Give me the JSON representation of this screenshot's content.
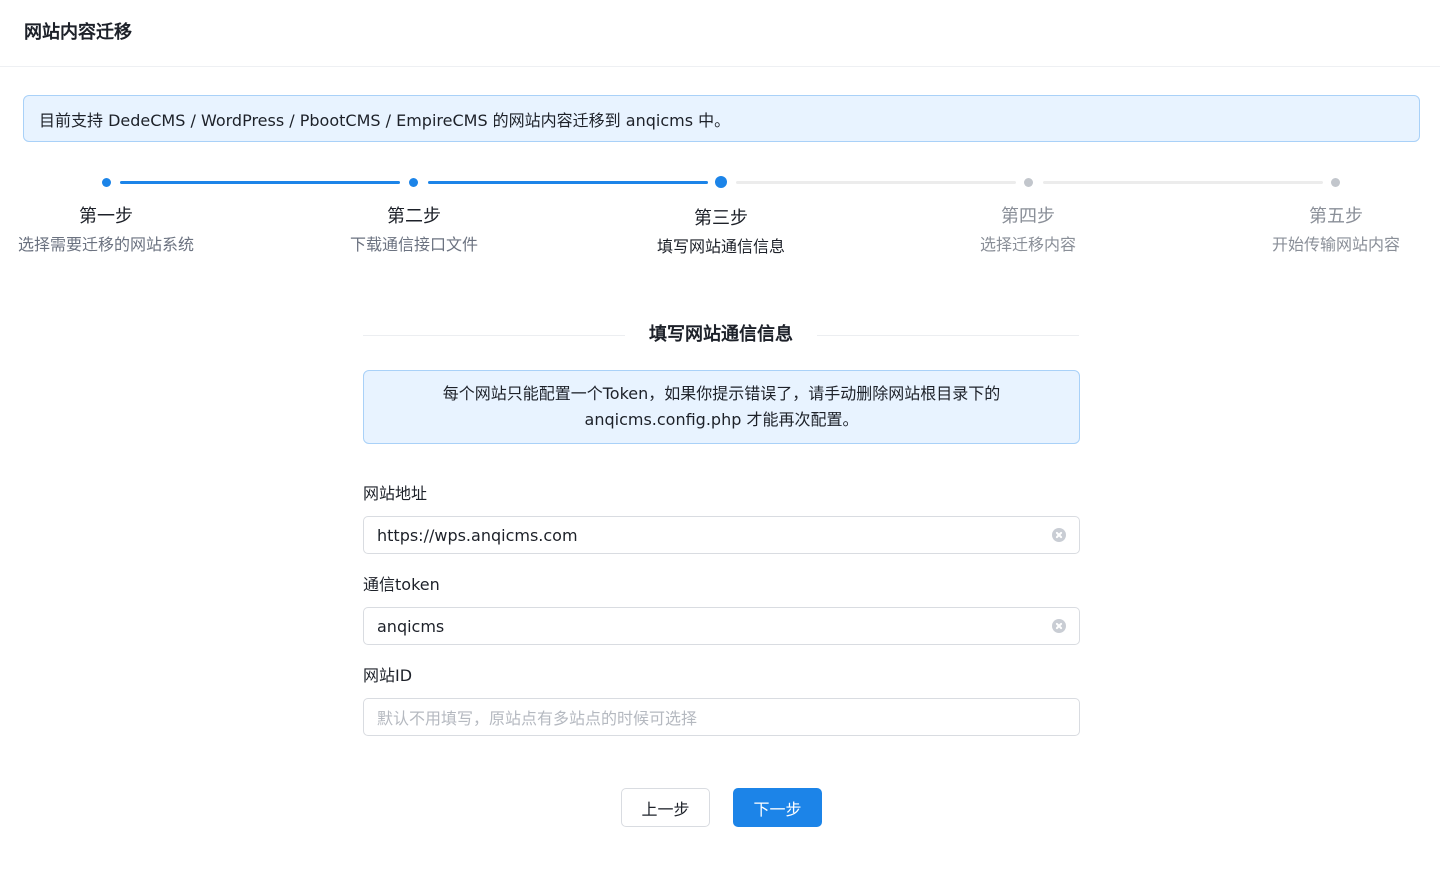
{
  "header": {
    "title": "网站内容迁移"
  },
  "notice": {
    "text": "目前支持 DedeCMS / WordPress / PbootCMS / EmpireCMS 的网站内容迁移到 anqicms 中。"
  },
  "steps": [
    {
      "title": "第一步",
      "desc": "选择需要迁移的网站系统",
      "state": "done"
    },
    {
      "title": "第二步",
      "desc": "下载通信接口文件",
      "state": "done"
    },
    {
      "title": "第三步",
      "desc": "填写网站通信信息",
      "state": "active"
    },
    {
      "title": "第四步",
      "desc": "选择迁移内容",
      "state": "pending"
    },
    {
      "title": "第五步",
      "desc": "开始传输网站内容",
      "state": "pending"
    }
  ],
  "section": {
    "title": "填写网站通信信息",
    "info_line1": "每个网站只能配置一个Token，如果你提示错误了，请手动删除网站根目录下的",
    "info_line2": "anqicms.config.php 才能再次配置。"
  },
  "form": {
    "site_url": {
      "label": "网站地址",
      "value": "https://wps.anqicms.com"
    },
    "token": {
      "label": "通信token",
      "value": "anqicms"
    },
    "site_id": {
      "label": "网站ID",
      "value": "",
      "placeholder": "默认不用填写，原站点有多站点的时候可选择"
    }
  },
  "actions": {
    "prev_label": "上一步",
    "next_label": "下一步"
  },
  "colors": {
    "primary": "#1c84e8",
    "notice_bg": "#e8f3ff",
    "notice_border": "#a9d1f8"
  },
  "icons": {
    "clear": "clear-icon"
  }
}
